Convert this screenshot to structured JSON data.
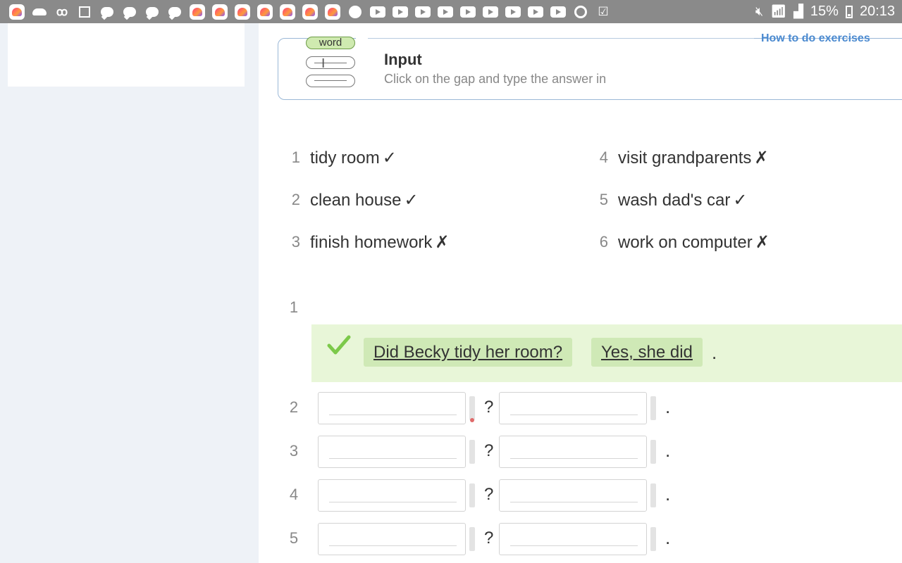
{
  "status_bar": {
    "battery": "15%",
    "time": "20:13",
    "left_icons": [
      "heart-app-icon",
      "cloud-icon",
      "odnoklassniki-icon",
      "gallery-icon",
      "chat-bubble-icon",
      "chat-bubble-icon",
      "chat-bubble-icon",
      "chat-bubble-icon",
      "heart-app-icon",
      "heart-app-icon",
      "heart-app-icon",
      "heart-app-icon",
      "heart-app-icon",
      "heart-app-icon",
      "heart-app-icon",
      "notification-icon",
      "youtube-icon",
      "youtube-icon",
      "youtube-icon",
      "youtube-icon",
      "youtube-icon",
      "youtube-icon",
      "youtube-icon",
      "youtube-icon",
      "youtube-icon",
      "chrome-icon",
      "check-icon"
    ]
  },
  "instructions": {
    "link": "How to do exercises",
    "illustration_word": "word",
    "title": "Input",
    "subtitle": "Click on the gap and type the answer in"
  },
  "prompts": [
    {
      "num": "1",
      "text": "tidy room",
      "mark": "✓"
    },
    {
      "num": "2",
      "text": "clean house",
      "mark": "✓"
    },
    {
      "num": "3",
      "text": "finish homework",
      "mark": "✗"
    },
    {
      "num": "4",
      "text": "visit grandparents",
      "mark": "✗"
    },
    {
      "num": "5",
      "text": "wash dad's car",
      "mark": "✓"
    },
    {
      "num": "6",
      "text": "work on computer",
      "mark": "✗"
    }
  ],
  "questions": [
    {
      "num": "1",
      "question": "Did Becky tidy her room?",
      "answer": "Yes, she did",
      "end": "."
    },
    {
      "num": "2",
      "question_value": "",
      "answer_value": "",
      "qmark": "?",
      "end": "."
    },
    {
      "num": "3",
      "question_value": "",
      "answer_value": "",
      "qmark": "?",
      "end": "."
    },
    {
      "num": "4",
      "question_value": "",
      "answer_value": "",
      "qmark": "?",
      "end": "."
    },
    {
      "num": "5",
      "question_value": "",
      "answer_value": "",
      "qmark": "?",
      "end": "."
    }
  ],
  "colors": {
    "accent_link": "#4b8ad0",
    "correct_bg": "#e8f6d8",
    "correct_pill": "#cfe9b6",
    "correct_tick": "#7cc94a"
  }
}
